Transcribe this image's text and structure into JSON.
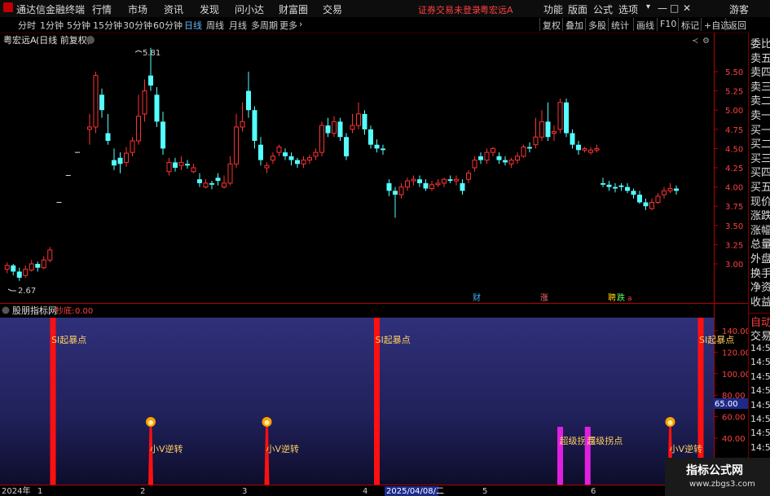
{
  "app": {
    "title": "通达信金融终端",
    "menu": [
      "行情",
      "市场",
      "资讯",
      "发现",
      "问小达",
      "财富圈",
      "交易"
    ],
    "notice": "证券交易未登录",
    "stock_name": "粤宏远A",
    "right_menu": [
      "功能",
      "版面",
      "公式",
      "选项"
    ],
    "user": "游客",
    "win_controls": [
      "▾",
      "—",
      "□",
      "✕"
    ]
  },
  "toolbar": {
    "periods": [
      "分时",
      "1分钟",
      "5分钟",
      "15分钟",
      "30分钟",
      "60分钟",
      "日线",
      "周线",
      "月线",
      "多周期",
      "更多"
    ],
    "active_period": "日线",
    "buttons": [
      "复权",
      "叠加",
      "多股",
      "统计",
      "画线",
      "F10",
      "标记",
      "+自选",
      "返回"
    ]
  },
  "main_chart": {
    "header_name": "粤宏远A",
    "header_desc": "(日线 前复权)",
    "price_axis": [
      "5.50",
      "5.25",
      "5.00",
      "4.75",
      "4.50",
      "4.25",
      "4.00",
      "3.75",
      "3.50",
      "3.25",
      "3.00"
    ],
    "high_label": "5.81",
    "low_label": "2.67",
    "event_marks": [
      "财",
      "涨",
      "聘",
      "跌",
      "a"
    ],
    "colors": {
      "up": "#ff3232",
      "down": "#54ffff",
      "axis": "#b40000"
    }
  },
  "indicator": {
    "name": "股朋指标网",
    "param_label": "抄底:",
    "param_value": "0.00",
    "axis_labels": [
      "140.00",
      "120.00",
      "100.00",
      "80.00",
      "60.00",
      "40.00"
    ],
    "current_value": "65.00",
    "signal_labels": {
      "qibao": "SI起暴点",
      "nixv": "小V逆转",
      "guaidian": "超级拐点"
    }
  },
  "date_axis": {
    "labels": [
      "2024年",
      "1",
      "2",
      "3",
      "4",
      "5",
      "6"
    ],
    "current": "2025/04/08/二"
  },
  "right_panel": {
    "quote_labels": [
      "委比",
      "卖五",
      "卖四",
      "卖三",
      "卖二",
      "卖一",
      "买一",
      "买二",
      "买三",
      "买四",
      "买五",
      "现价",
      "涨跌",
      "涨幅",
      "总量",
      "外盘",
      "换手",
      "净资",
      "收益"
    ],
    "tabs": [
      "自动",
      "交易"
    ],
    "trade_times": [
      "14:56",
      "14:56",
      "14:56",
      "14:56",
      "14:56",
      "14:56",
      "14:56",
      "14:56",
      "14:56",
      "14:56"
    ]
  },
  "watermark": {
    "line1": "指标公式网",
    "line2": "www.zbgs3.com"
  },
  "chart_data": {
    "type": "candlestick",
    "ylim": [
      2.6,
      5.9
    ],
    "candles": [
      [
        2.93,
        2.98,
        3.02,
        2.88
      ],
      [
        2.98,
        2.9,
        3.0,
        2.85
      ],
      [
        2.9,
        2.82,
        2.95,
        2.78
      ],
      [
        2.85,
        2.93,
        2.98,
        2.82
      ],
      [
        2.92,
        3.0,
        3.05,
        2.9
      ],
      [
        3.0,
        2.95,
        3.03,
        2.9
      ],
      [
        2.95,
        3.05,
        3.1,
        2.93
      ],
      [
        3.05,
        3.18,
        3.22,
        3.02
      ],
      [
        4.75,
        4.78,
        4.95,
        4.55
      ],
      [
        4.78,
        5.45,
        5.5,
        4.7
      ],
      [
        5.2,
        5.0,
        5.28,
        4.9
      ],
      [
        4.7,
        4.6,
        4.95,
        4.55
      ],
      [
        4.35,
        4.28,
        4.5,
        4.22
      ],
      [
        4.38,
        4.3,
        4.45,
        4.18
      ],
      [
        4.32,
        4.44,
        4.52,
        4.26
      ],
      [
        4.45,
        4.6,
        4.65,
        4.4
      ],
      [
        4.6,
        4.92,
        5.2,
        4.55
      ],
      [
        4.95,
        5.25,
        5.4,
        4.85
      ],
      [
        5.45,
        5.32,
        5.81,
        5.25
      ],
      [
        5.2,
        4.85,
        5.3,
        4.78
      ],
      [
        4.85,
        4.5,
        4.98,
        4.42
      ],
      [
        4.2,
        4.32,
        4.38,
        4.15
      ],
      [
        4.32,
        4.25,
        4.38,
        4.2
      ],
      [
        4.28,
        4.32,
        4.4,
        4.22
      ],
      [
        4.3,
        4.28,
        4.35,
        4.24
      ],
      [
        4.2,
        4.25,
        4.3,
        4.18
      ],
      [
        4.1,
        4.05,
        4.18,
        4.0
      ],
      [
        4.0,
        4.05,
        4.1,
        3.98
      ],
      [
        4.05,
        4.03,
        4.08,
        3.97
      ],
      [
        4.12,
        4.08,
        4.18,
        4.02
      ],
      [
        4.0,
        4.05,
        4.15,
        3.98
      ],
      [
        4.05,
        4.3,
        4.4,
        4.02
      ],
      [
        4.3,
        4.78,
        4.95,
        4.25
      ],
      [
        4.78,
        4.85,
        5.1,
        4.72
      ],
      [
        5.25,
        5.0,
        5.5,
        4.9
      ],
      [
        5.0,
        4.6,
        5.05,
        4.5
      ],
      [
        4.55,
        4.35,
        4.65,
        4.28
      ],
      [
        4.25,
        4.28,
        4.32,
        4.18
      ],
      [
        4.35,
        4.4,
        4.45,
        4.3
      ],
      [
        4.45,
        4.52,
        4.55,
        4.4
      ],
      [
        4.45,
        4.4,
        4.5,
        4.35
      ],
      [
        4.4,
        4.35,
        4.45,
        4.28
      ],
      [
        4.35,
        4.3,
        4.38,
        4.25
      ],
      [
        4.3,
        4.35,
        4.4,
        4.25
      ],
      [
        4.35,
        4.38,
        4.42,
        4.3
      ],
      [
        4.4,
        4.45,
        4.5,
        4.35
      ],
      [
        4.45,
        4.8,
        4.85,
        4.4
      ],
      [
        4.8,
        4.7,
        4.9,
        4.65
      ],
      [
        4.7,
        4.85,
        4.92,
        4.65
      ],
      [
        4.85,
        4.65,
        4.9,
        4.6
      ],
      [
        4.65,
        4.4,
        4.7,
        4.35
      ],
      [
        4.75,
        4.8,
        4.95,
        4.7
      ],
      [
        4.8,
        4.95,
        5.1,
        4.75
      ],
      [
        4.95,
        4.75,
        5.0,
        4.68
      ],
      [
        4.75,
        4.55,
        4.8,
        4.5
      ],
      [
        4.55,
        4.5,
        4.62,
        4.45
      ],
      [
        4.5,
        4.48,
        4.55,
        4.42
      ],
      [
        4.05,
        3.95,
        4.1,
        3.88
      ],
      [
        3.95,
        3.9,
        4.0,
        3.6
      ],
      [
        3.9,
        4.0,
        4.05,
        3.85
      ],
      [
        4.0,
        4.08,
        4.12,
        3.95
      ],
      [
        4.08,
        4.1,
        4.15,
        4.02
      ],
      [
        4.1,
        4.05,
        4.15,
        4.0
      ],
      [
        4.05,
        3.98,
        4.1,
        3.95
      ],
      [
        3.98,
        4.03,
        4.08,
        3.95
      ],
      [
        4.03,
        4.05,
        4.1,
        4.0
      ],
      [
        4.05,
        4.1,
        4.12,
        4.0
      ],
      [
        4.1,
        4.08,
        4.15,
        4.05
      ],
      [
        4.08,
        4.1,
        4.15,
        4.02
      ],
      [
        4.05,
        3.95,
        4.1,
        3.9
      ],
      [
        4.1,
        4.18,
        4.22,
        4.05
      ],
      [
        4.25,
        4.35,
        4.4,
        4.2
      ],
      [
        4.4,
        4.35,
        4.45,
        4.3
      ],
      [
        4.35,
        4.45,
        4.5,
        4.3
      ],
      [
        4.45,
        4.5,
        4.52,
        4.4
      ],
      [
        4.4,
        4.35,
        4.45,
        4.3
      ],
      [
        4.35,
        4.32,
        4.4,
        4.28
      ],
      [
        4.3,
        4.35,
        4.38,
        4.25
      ],
      [
        4.35,
        4.4,
        4.45,
        4.3
      ],
      [
        4.4,
        4.52,
        4.55,
        4.38
      ],
      [
        4.52,
        4.5,
        4.58,
        4.45
      ],
      [
        4.55,
        4.65,
        4.9,
        4.5
      ],
      [
        4.65,
        4.85,
        5.0,
        4.6
      ],
      [
        4.85,
        4.65,
        5.1,
        4.6
      ],
      [
        4.7,
        4.72,
        4.8,
        4.6
      ],
      [
        4.75,
        5.1,
        5.15,
        4.7
      ],
      [
        5.1,
        4.7,
        5.15,
        4.65
      ],
      [
        4.7,
        4.55,
        4.75,
        4.5
      ],
      [
        4.55,
        4.48,
        4.6,
        4.42
      ],
      [
        4.48,
        4.5,
        4.52,
        4.45
      ],
      [
        4.45,
        4.48,
        4.52,
        4.42
      ],
      [
        4.48,
        4.5,
        4.55,
        4.45
      ],
      [
        4.05,
        4.03,
        4.12,
        4.0
      ],
      [
        4.03,
        4.0,
        4.08,
        3.95
      ],
      [
        4.0,
        3.98,
        4.05,
        3.93
      ],
      [
        4.02,
        4.0,
        4.05,
        3.95
      ],
      [
        4.0,
        3.95,
        4.05,
        3.92
      ],
      [
        3.95,
        3.9,
        3.98,
        3.85
      ],
      [
        3.9,
        3.8,
        3.95,
        3.78
      ],
      [
        3.8,
        3.75,
        3.85,
        3.7
      ],
      [
        3.72,
        3.8,
        3.85,
        3.7
      ],
      [
        3.8,
        3.88,
        3.92,
        3.78
      ],
      [
        3.9,
        3.95,
        4.0,
        3.85
      ],
      [
        3.95,
        3.98,
        4.05,
        3.92
      ],
      [
        3.98,
        3.95,
        4.02,
        3.9
      ]
    ],
    "candle_x": [
      0.5,
      1.5,
      2.5,
      3.5,
      4.5,
      5.5,
      6.5,
      7.5,
      14,
      15,
      16,
      17,
      18,
      19,
      20,
      21,
      22,
      23,
      24,
      25,
      26,
      27,
      28,
      29,
      30,
      31,
      32,
      33,
      34,
      35,
      36,
      37,
      38,
      39,
      40,
      41,
      42,
      43,
      44,
      45,
      46,
      47,
      48,
      49,
      50,
      51,
      52,
      53,
      54,
      55,
      56,
      57,
      58,
      59,
      60,
      61,
      62,
      63,
      64,
      65,
      66,
      67,
      68,
      69,
      70,
      71,
      72,
      73,
      74,
      75,
      76,
      77,
      78,
      79,
      80,
      81,
      82,
      83,
      84,
      85,
      86,
      87,
      88,
      89,
      90,
      91,
      92,
      93,
      94,
      95,
      96,
      97,
      98,
      99,
      100,
      101,
      102,
      103,
      104,
      105,
      106,
      107,
      108,
      109,
      110,
      111,
      112,
      113,
      114,
      115,
      116,
      117
    ],
    "ticks": [
      [
        9,
        3.8
      ],
      [
        10.5,
        4.15
      ],
      [
        12,
        4.45
      ]
    ],
    "indicator_signals": {
      "tall": [
        8,
        61,
        114
      ],
      "nixv": [
        24,
        43,
        109
      ],
      "guaidian": [
        91,
        95.5
      ]
    }
  }
}
